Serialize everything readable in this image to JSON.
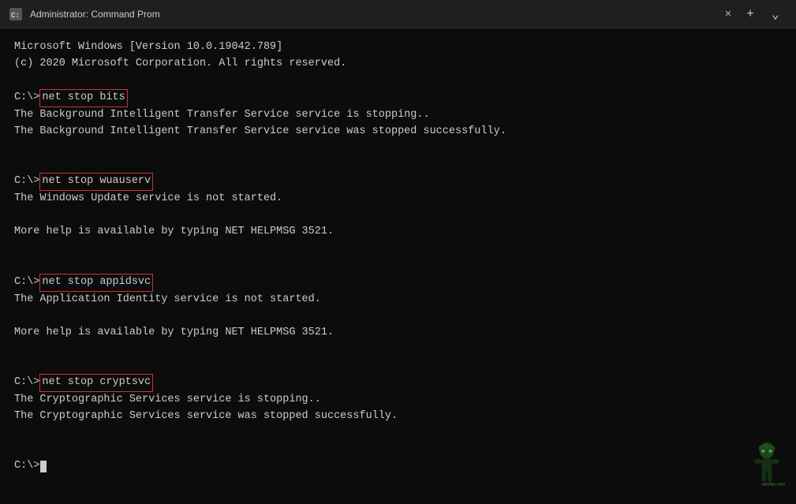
{
  "titlebar": {
    "icon": "cmd-icon",
    "title": "Administrator: Command Prom",
    "close_label": "✕",
    "add_label": "+",
    "dropdown_label": "⌄"
  },
  "terminal": {
    "lines": [
      {
        "type": "text",
        "content": "Microsoft Windows [Version 10.0.19042.789]"
      },
      {
        "type": "text",
        "content": "(c) 2020 Microsoft Corporation. All rights reserved."
      },
      {
        "type": "blank"
      },
      {
        "type": "cmd",
        "prompt": "C:\\>",
        "command": "net stop bits"
      },
      {
        "type": "text",
        "content": "The Background Intelligent Transfer Service service is stopping.."
      },
      {
        "type": "text",
        "content": "The Background Intelligent Transfer Service service was stopped successfully."
      },
      {
        "type": "blank"
      },
      {
        "type": "blank"
      },
      {
        "type": "cmd",
        "prompt": "C:\\>",
        "command": "net stop wuauserv"
      },
      {
        "type": "text",
        "content": "The Windows Update service is not started."
      },
      {
        "type": "blank"
      },
      {
        "type": "text",
        "content": "More help is available by typing NET HELPMSG 3521."
      },
      {
        "type": "blank"
      },
      {
        "type": "blank"
      },
      {
        "type": "cmd",
        "prompt": "C:\\>",
        "command": "net stop appidsvc"
      },
      {
        "type": "text",
        "content": "The Application Identity service is not started."
      },
      {
        "type": "blank"
      },
      {
        "type": "text",
        "content": "More help is available by typing NET HELPMSG 3521."
      },
      {
        "type": "blank"
      },
      {
        "type": "blank"
      },
      {
        "type": "cmd",
        "prompt": "C:\\>",
        "command": "net stop cryptsvc"
      },
      {
        "type": "text",
        "content": "The Cryptographic Services service is stopping.."
      },
      {
        "type": "text",
        "content": "The Cryptographic Services service was stopped successfully."
      },
      {
        "type": "blank"
      },
      {
        "type": "blank"
      },
      {
        "type": "prompt_only",
        "prompt": "C:\\>"
      }
    ]
  }
}
